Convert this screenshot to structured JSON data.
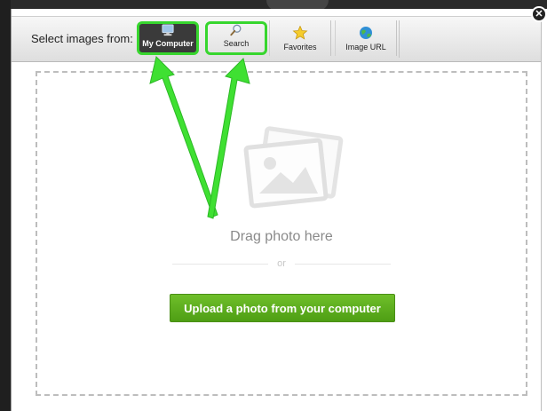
{
  "toolbar": {
    "label": "Select images from:",
    "tabs": {
      "my_computer": {
        "label": "My Computer",
        "icon": "monitor-icon"
      },
      "search": {
        "label": "Search",
        "icon": "magnifier-icon"
      },
      "favorites": {
        "label": "Favorites",
        "icon": "star-icon"
      },
      "image_url": {
        "label": "Image URL",
        "icon": "globe-icon"
      }
    }
  },
  "dropzone": {
    "drag_text": "Drag photo here",
    "or_text": "or",
    "upload_label": "Upload a photo from your computer"
  },
  "close_label": "✕",
  "colors": {
    "highlight": "#37d62e",
    "upload_button": "#5aab1c"
  }
}
